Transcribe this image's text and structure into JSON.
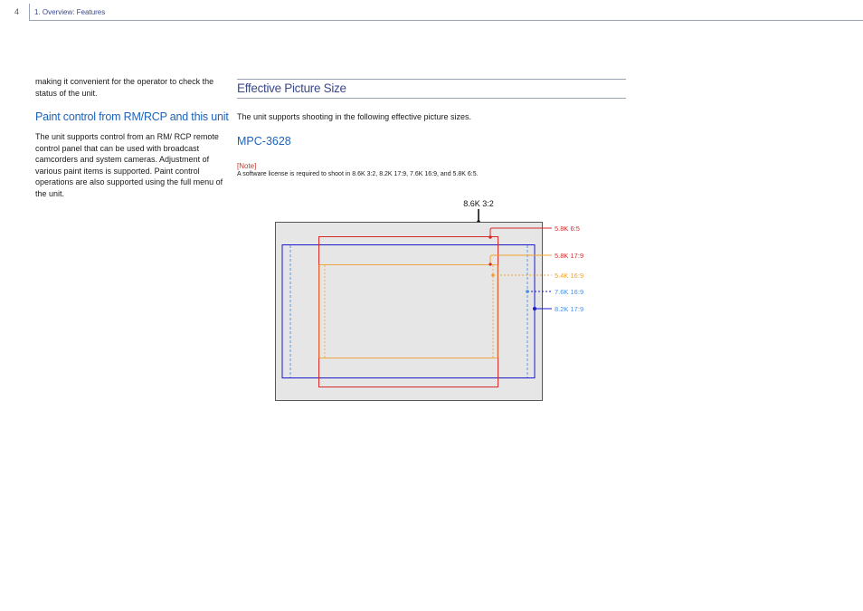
{
  "header": {
    "page_number": "4",
    "breadcrumb": "1. Overview: Features"
  },
  "left": {
    "continued_text": "making it convenient for the operator to check the status of the unit.",
    "heading": "Paint control from RM/RCP and this unit",
    "body": "The unit supports control from an RM/ RCP remote control panel that can be used with broadcast camcorders and system cameras. Adjustment of various paint items is supported. Paint control operations are also supported using the full menu of the unit."
  },
  "section": {
    "title": "Effective Picture Size",
    "intro": "The unit supports shooting in the following effective picture sizes.",
    "model": "MPC-3628",
    "note_label": "[Note]",
    "note_text": "A software license is required to shoot in 8.6K 3:2, 8.2K 17:9, 7.6K 16:9, and 5.8K 6:5."
  },
  "diagram": {
    "top_label": "8.6K 3:2",
    "labels": [
      {
        "text": "5.8K 6:5",
        "color": "#d42a2a"
      },
      {
        "text": "5.8K 17:9",
        "color": "#d42a2a"
      },
      {
        "text": "5.4K 16:9",
        "color": "#f0a030"
      },
      {
        "text": "7.6K 16:9",
        "color": "#4a90e2"
      },
      {
        "text": "8.2K 17:9",
        "color": "#4a90e2"
      }
    ],
    "colors": {
      "frame_fill": "#e6e6e6",
      "blue": "#1a1acc",
      "red": "#d42a2a",
      "orange": "#f0a030",
      "light_blue": "#4a90e2"
    }
  }
}
